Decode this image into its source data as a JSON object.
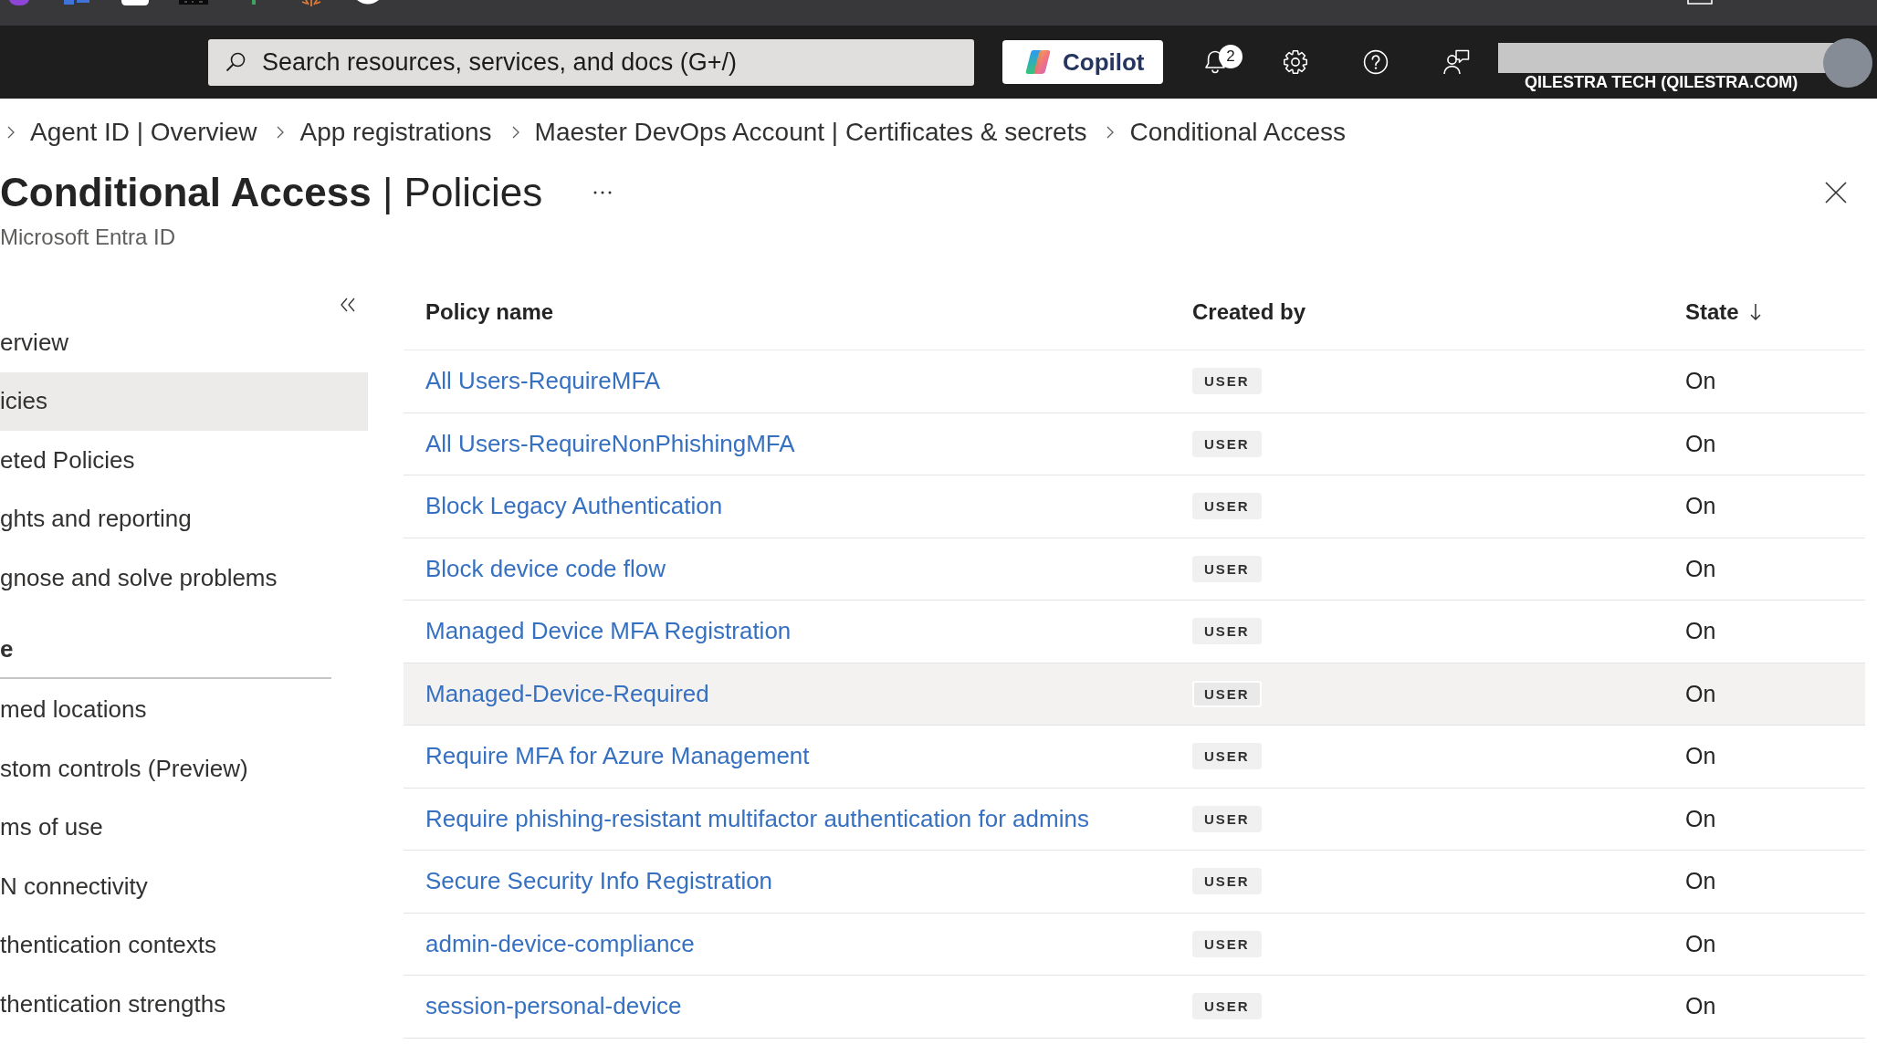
{
  "top_bar": {
    "search": {
      "placeholder": "Search resources, services, and docs (G+/)"
    },
    "copilot_button": {
      "label": "Copilot"
    },
    "notifications": {
      "count": "2"
    },
    "account": {
      "directory": "QILESTRA TECH (QILESTRA.COM)"
    }
  },
  "breadcrumb": [
    "Agent ID | Overview",
    "App registrations",
    "Maester DevOps Account | Certificates & secrets",
    "Conditional Access"
  ],
  "page": {
    "title": "**Conditional Access** | Policies",
    "subtitle": "Microsoft Entra ID"
  },
  "sidebar": {
    "items": [
      {
        "kind": "item",
        "label": "erview",
        "selected": false
      },
      {
        "kind": "item",
        "label": "icies",
        "selected": true
      },
      {
        "kind": "item",
        "label": "eted Policies",
        "selected": false
      },
      {
        "kind": "item",
        "label": "ghts and reporting",
        "selected": false
      },
      {
        "kind": "item",
        "label": "gnose and solve problems",
        "selected": false
      },
      {
        "kind": "section",
        "label": "e"
      },
      {
        "kind": "item",
        "label": "med locations",
        "selected": false
      },
      {
        "kind": "item",
        "label": "stom controls (Preview)",
        "selected": false
      },
      {
        "kind": "item",
        "label": "ms of use",
        "selected": false
      },
      {
        "kind": "item",
        "label": "N connectivity",
        "selected": false
      },
      {
        "kind": "item",
        "label": "thentication contexts",
        "selected": false
      },
      {
        "kind": "item",
        "label": "thentication strengths",
        "selected": false
      }
    ]
  },
  "table": {
    "columns": [
      {
        "label": "Policy name",
        "sorted": false
      },
      {
        "label": "Created by",
        "sorted": false
      },
      {
        "label": "State",
        "sorted": true
      }
    ],
    "rows": [
      {
        "policy_name": "All Users-RequireMFA",
        "created_by": "USER",
        "state": "On",
        "hovered": false
      },
      {
        "policy_name": "All Users-RequireNonPhishingMFA",
        "created_by": "USER",
        "state": "On",
        "hovered": false
      },
      {
        "policy_name": "Block Legacy Authentication",
        "created_by": "USER",
        "state": "On",
        "hovered": false
      },
      {
        "policy_name": "Block device code flow",
        "created_by": "USER",
        "state": "On",
        "hovered": false
      },
      {
        "policy_name": "Managed Device MFA Registration",
        "created_by": "USER",
        "state": "On",
        "hovered": false
      },
      {
        "policy_name": "Managed-Device-Required",
        "created_by": "USER",
        "state": "On",
        "hovered": true
      },
      {
        "policy_name": "Require MFA for Azure Management",
        "created_by": "USER",
        "state": "On",
        "hovered": false
      },
      {
        "policy_name": "Require phishing-resistant multifactor authentication for admins",
        "created_by": "USER",
        "state": "On",
        "hovered": false
      },
      {
        "policy_name": "Secure Security Info Registration",
        "created_by": "USER",
        "state": "On",
        "hovered": false
      },
      {
        "policy_name": "admin-device-compliance",
        "created_by": "USER",
        "state": "On",
        "hovered": false
      },
      {
        "policy_name": "session-personal-device",
        "created_by": "USER",
        "state": "On",
        "hovered": false
      }
    ]
  }
}
